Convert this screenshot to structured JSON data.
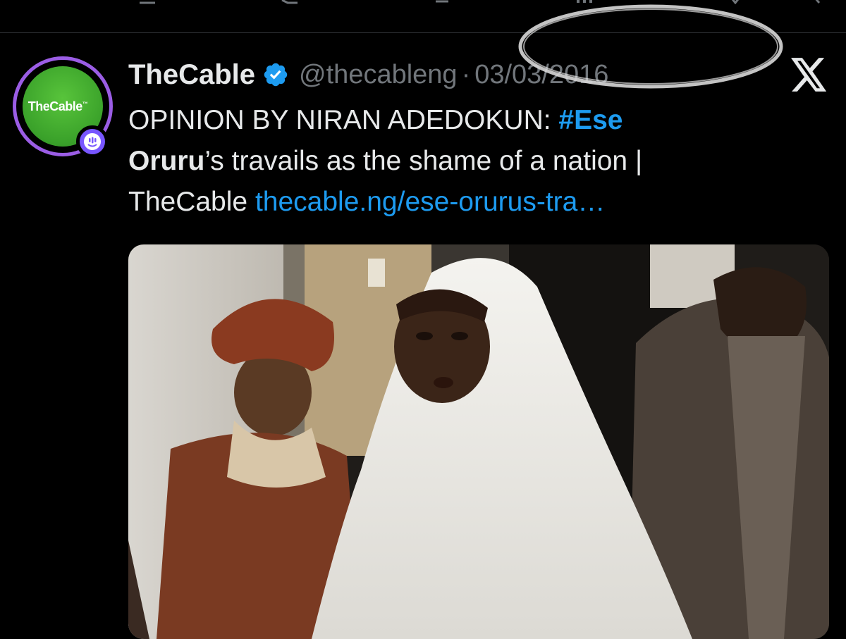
{
  "tweet": {
    "author_name": "TheCable",
    "handle": "@thecableng",
    "separator": "·",
    "date": "03/03/2016",
    "avatar_text": "TheCable",
    "avatar_mark": "™",
    "text_line1_prefix": "OPINION BY NIRAN ADEDOKUN: ",
    "hashtag_part1": "#Ese",
    "hashtag_part2": "Oruru",
    "text_line2_rest": "’s travails as the shame of a nation |",
    "text_line3_prefix": "TheCable ",
    "link_text": "thecable.ng/ese-orurus-tra…"
  },
  "icons": {
    "verified": "verified-badge-icon",
    "spaces": "spaces-live-icon",
    "x_logo": "x-logo-icon"
  },
  "colors": {
    "background": "#000000",
    "text": "#e7e9ea",
    "muted": "#71767b",
    "link": "#1d9bf0",
    "avatar_green": "#3aa12a",
    "spaces_purple": "#7856ff"
  }
}
